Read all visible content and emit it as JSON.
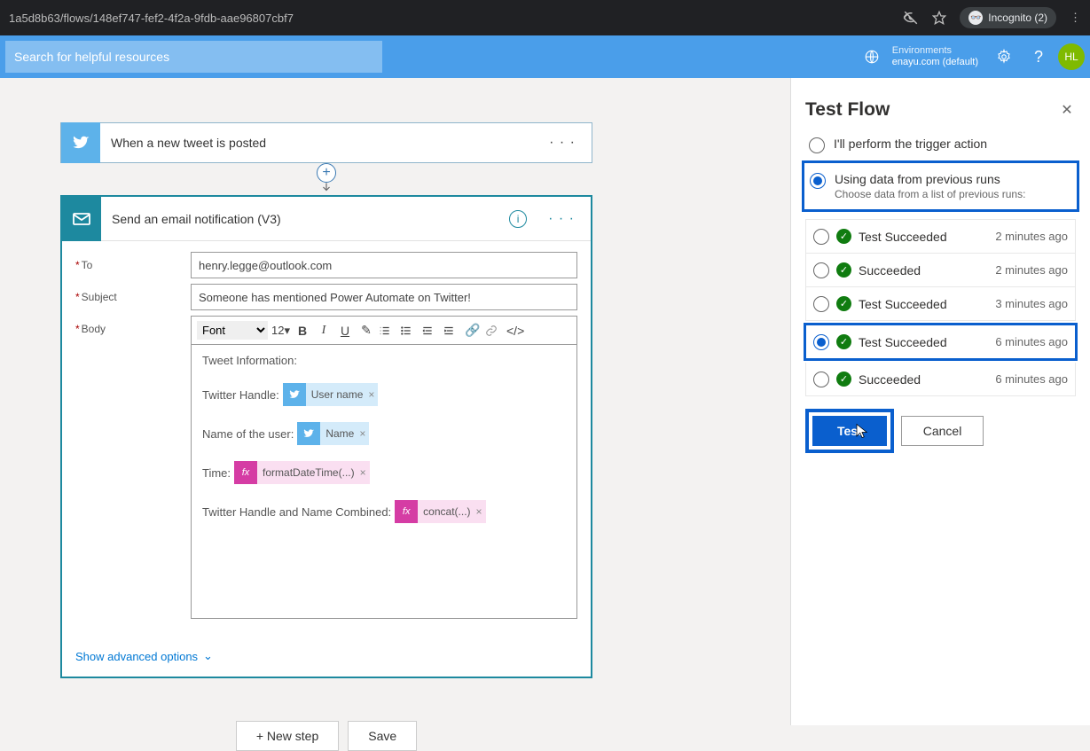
{
  "browser": {
    "url": "1a5d8b63/flows/148ef747-fef2-4f2a-9fdb-aae96807cbf7",
    "incognito": "Incognito (2)"
  },
  "header": {
    "search_placeholder": "Search for helpful resources",
    "env_label": "Environments",
    "env_value": "enayu.com (default)",
    "avatar": "HL"
  },
  "trigger": {
    "title": "When a new tweet is posted"
  },
  "action": {
    "title": "Send an email notification (V3)",
    "labels": {
      "to": "To",
      "subject": "Subject",
      "body": "Body"
    },
    "to_value": "henry.legge@outlook.com",
    "subject_value": "Someone has mentioned Power Automate on Twitter!",
    "font_label": "Font",
    "size_label": "12",
    "body_lines": {
      "l0": "Tweet Information:",
      "l1": "Twitter Handle:",
      "l2": "Name of the user:",
      "l3": "Time:",
      "l4": "Twitter Handle and Name Combined:"
    },
    "tokens": {
      "username": "User name",
      "name": "Name",
      "fmt": "formatDateTime(...)",
      "concat": "concat(...)"
    },
    "advanced": "Show advanced options"
  },
  "footer": {
    "new_step": "+ New step",
    "save": "Save"
  },
  "panel": {
    "title": "Test Flow",
    "opt1": "I'll perform the trigger action",
    "opt2": "Using data from previous runs",
    "opt2_sub": "Choose data from a list of previous runs:",
    "runs": [
      {
        "label": "Test Succeeded",
        "time": "2 minutes ago",
        "selected": false
      },
      {
        "label": "Succeeded",
        "time": "2 minutes ago",
        "selected": false
      },
      {
        "label": "Test Succeeded",
        "time": "3 minutes ago",
        "selected": false
      },
      {
        "label": "Test Succeeded",
        "time": "6 minutes ago",
        "selected": true
      },
      {
        "label": "Succeeded",
        "time": "6 minutes ago",
        "selected": false
      }
    ],
    "test_btn": "Test",
    "cancel_btn": "Cancel"
  }
}
